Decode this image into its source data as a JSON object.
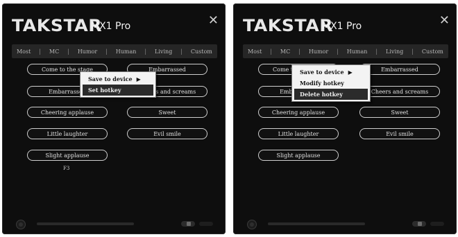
{
  "left": {
    "brand": "TAKSTAR",
    "model": "MX1 Pro",
    "close_glyph": "✕",
    "tabs": [
      "Most",
      "MC",
      "Humor",
      "Human",
      "Living",
      "Custom"
    ],
    "tab_sep": "|",
    "buttons": [
      "Come to the stage",
      "Embarrassed",
      "Embarrassed",
      "Cheers and screams",
      "Cheering applause",
      "Sweet",
      "Little laughter",
      "Evil smile",
      "Slight applause"
    ],
    "hotkey_value": "F3",
    "context_menu": {
      "save_to_device": "Save to device",
      "arrow": "▶",
      "set_hotkey": "Set hotkey"
    }
  },
  "right": {
    "brand": "TAKSTAR",
    "model": "MX1 Pro",
    "close_glyph": "✕",
    "tabs": [
      "Most",
      "MC",
      "Humor",
      "Human",
      "Living",
      "Custom"
    ],
    "tab_sep": "|",
    "buttons": [
      "Come to the stage",
      "Embarrassed",
      "Embarrassed",
      "Cheers and screams",
      "Cheering applause",
      "Sweet",
      "Little laughter",
      "Evil smile",
      "Slight applause"
    ],
    "context_menu": {
      "save_to_device": "Save to device",
      "arrow": "▶",
      "modify_hotkey": "Modify hotkey",
      "delete_hotkey": "Delete hotkey"
    }
  },
  "colors": {
    "window_bg": "#0e0e0e",
    "tab_bar": "#262626",
    "button_border": "#cfcfcf",
    "menu_bg": "#f3f3f3",
    "menu_highlight": "#2b2b2b"
  }
}
